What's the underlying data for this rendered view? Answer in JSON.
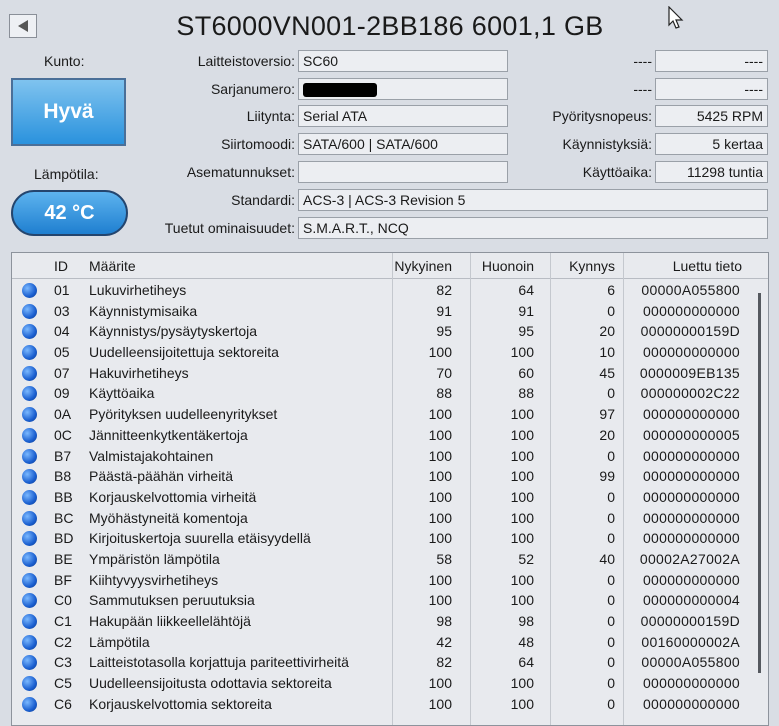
{
  "header": {
    "title": "ST6000VN001-2BB186 6001,1 GB"
  },
  "status": {
    "health_label": "Kunto:",
    "health_value": "Hyvä",
    "temperature_label": "Lämpötila:",
    "temperature_value": "42 °C"
  },
  "info": {
    "firmware_label": "Laitteistoversio:",
    "firmware_value": "SC60",
    "serial_label": "Sarjanumero:",
    "interface_label": "Liitynta:",
    "interface_value": "Serial ATA",
    "transfer_label": "Siirtomoodi:",
    "transfer_value": "SATA/600 | SATA/600",
    "drive_letter_label": "Asematunnukset:",
    "drive_letter_value": "",
    "standard_label": "Standardi:",
    "standard_value": "ACS-3 | ACS-3 Revision 5",
    "features_label": "Tuetut ominaisuudet:",
    "features_value": "S.M.A.R.T., NCQ",
    "right_top_label": "----",
    "right_top_value": "----",
    "right_second_label": "----",
    "right_second_value": "----",
    "rotation_label": "Pyöritysnopeus:",
    "rotation_value": "5425 RPM",
    "power_on_count_label": "Käynnistyksiä:",
    "power_on_count_value": "5 kertaa",
    "power_on_hours_label": "Käyttöaika:",
    "power_on_hours_value": "11298 tuntia"
  },
  "table": {
    "headers": {
      "id": "ID",
      "attribute": "Määrite",
      "current": "Nykyinen",
      "worst": "Huonoin",
      "threshold": "Kynnys",
      "raw": "Luettu tieto"
    },
    "rows": [
      {
        "id": "01",
        "name": "Lukuvirhetiheys",
        "current": "82",
        "worst": "64",
        "threshold": "6",
        "raw": "00000A055800"
      },
      {
        "id": "03",
        "name": "Käynnistymisaika",
        "current": "91",
        "worst": "91",
        "threshold": "0",
        "raw": "000000000000"
      },
      {
        "id": "04",
        "name": "Käynnistys/pysäytyskertoja",
        "current": "95",
        "worst": "95",
        "threshold": "20",
        "raw": "00000000159D"
      },
      {
        "id": "05",
        "name": "Uudelleensijoitettuja sektoreita",
        "current": "100",
        "worst": "100",
        "threshold": "10",
        "raw": "000000000000"
      },
      {
        "id": "07",
        "name": "Hakuvirhetiheys",
        "current": "70",
        "worst": "60",
        "threshold": "45",
        "raw": "0000009EB135"
      },
      {
        "id": "09",
        "name": "Käyttöaika",
        "current": "88",
        "worst": "88",
        "threshold": "0",
        "raw": "000000002C22"
      },
      {
        "id": "0A",
        "name": "Pyörityksen uudelleenyritykset",
        "current": "100",
        "worst": "100",
        "threshold": "97",
        "raw": "000000000000"
      },
      {
        "id": "0C",
        "name": "Jännitteenkytkentäkertoja",
        "current": "100",
        "worst": "100",
        "threshold": "20",
        "raw": "000000000005"
      },
      {
        "id": "B7",
        "name": "Valmistajakohtainen",
        "current": "100",
        "worst": "100",
        "threshold": "0",
        "raw": "000000000000"
      },
      {
        "id": "B8",
        "name": "Päästä-päähän virheitä",
        "current": "100",
        "worst": "100",
        "threshold": "99",
        "raw": "000000000000"
      },
      {
        "id": "BB",
        "name": "Korjauskelvottomia virheitä",
        "current": "100",
        "worst": "100",
        "threshold": "0",
        "raw": "000000000000"
      },
      {
        "id": "BC",
        "name": "Myöhästyneitä komentoja",
        "current": "100",
        "worst": "100",
        "threshold": "0",
        "raw": "000000000000"
      },
      {
        "id": "BD",
        "name": "Kirjoituskertoja suurella etäisyydellä",
        "current": "100",
        "worst": "100",
        "threshold": "0",
        "raw": "000000000000"
      },
      {
        "id": "BE",
        "name": "Ympäristön lämpötila",
        "current": "58",
        "worst": "52",
        "threshold": "40",
        "raw": "00002A27002A"
      },
      {
        "id": "BF",
        "name": "Kiihtyvyysvirhetiheys",
        "current": "100",
        "worst": "100",
        "threshold": "0",
        "raw": "000000000000"
      },
      {
        "id": "C0",
        "name": "Sammutuksen peruutuksia",
        "current": "100",
        "worst": "100",
        "threshold": "0",
        "raw": "000000000004"
      },
      {
        "id": "C1",
        "name": "Hakupään liikkeellelähtöjä",
        "current": "98",
        "worst": "98",
        "threshold": "0",
        "raw": "00000000159D"
      },
      {
        "id": "C2",
        "name": "Lämpötila",
        "current": "42",
        "worst": "48",
        "threshold": "0",
        "raw": "00160000002A"
      },
      {
        "id": "C3",
        "name": "Laitteistotasolla korjattuja pariteettivirheitä",
        "current": "82",
        "worst": "64",
        "threshold": "0",
        "raw": "00000A055800"
      },
      {
        "id": "C5",
        "name": "Uudelleensijoitusta odottavia sektoreita",
        "current": "100",
        "worst": "100",
        "threshold": "0",
        "raw": "000000000000"
      },
      {
        "id": "C6",
        "name": "Korjauskelvottomia sektoreita",
        "current": "100",
        "worst": "100",
        "threshold": "0",
        "raw": "000000000000"
      }
    ]
  },
  "colors": {
    "background": "#d9dde4",
    "health_blue": "#2a92dd",
    "status_dot": "#1a5fd0"
  },
  "icons": {
    "back": "back-arrow-icon",
    "cursor": "mouse-cursor-icon",
    "status": "status-dot-icon"
  }
}
